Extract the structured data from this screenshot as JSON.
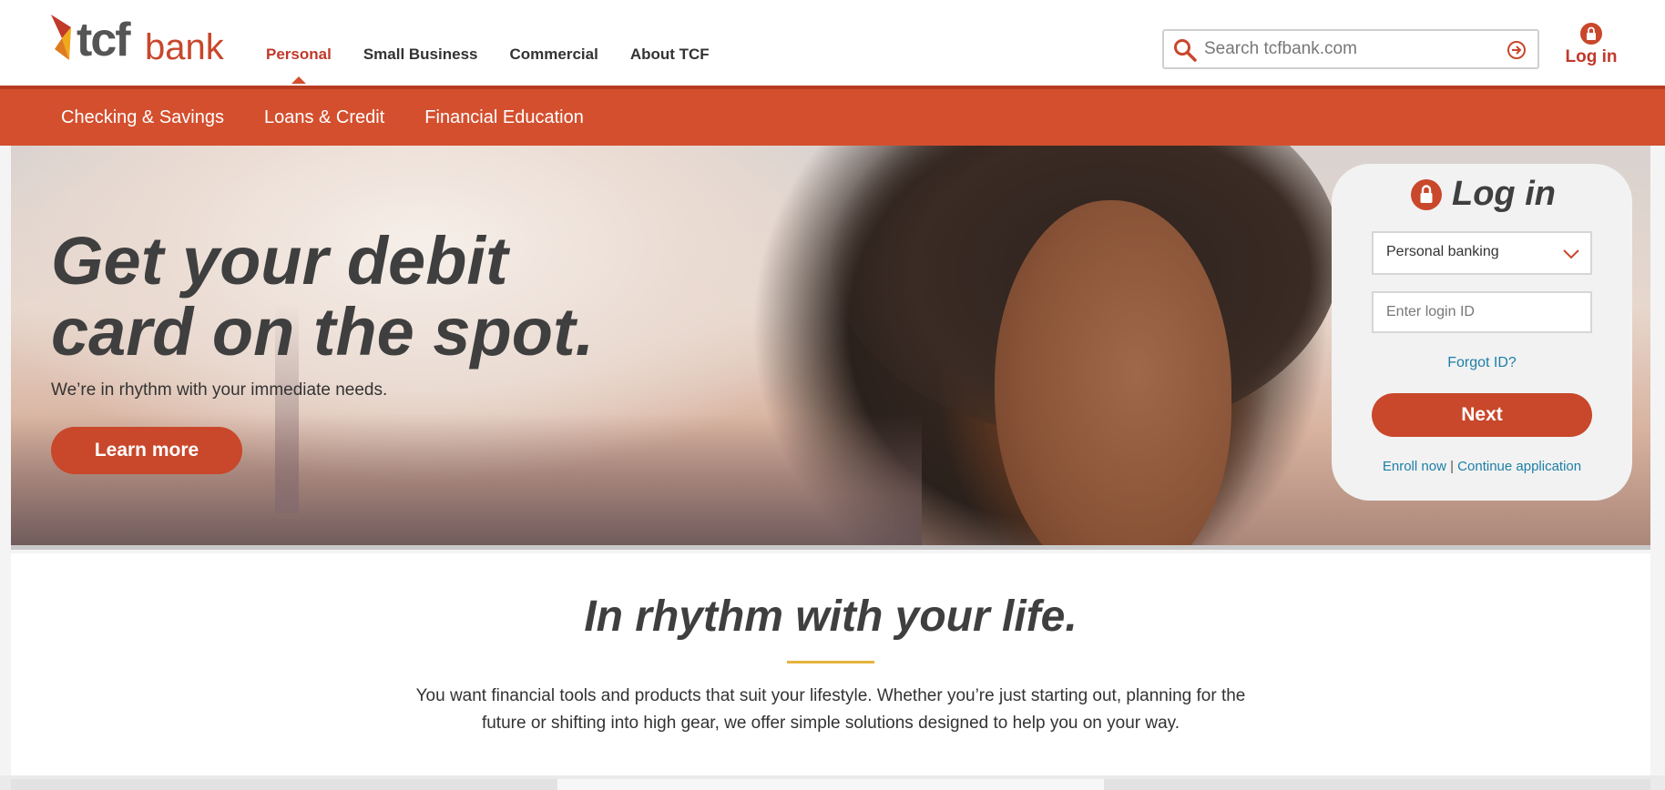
{
  "header": {
    "logo": {
      "wordmark": "tcf",
      "sub": "bank"
    },
    "nav": [
      {
        "label": "Personal",
        "active": true
      },
      {
        "label": "Small Business",
        "active": false
      },
      {
        "label": "Commercial",
        "active": false
      },
      {
        "label": "About TCF",
        "active": false
      }
    ],
    "search": {
      "placeholder": "Search tcfbank.com",
      "value": ""
    },
    "login_label": "Log in"
  },
  "subnav": {
    "items": [
      "Checking & Savings",
      "Loans & Credit",
      "Financial Education"
    ]
  },
  "hero": {
    "title": "Get your debit card on the spot.",
    "subtitle": "We’re in rhythm with your immediate needs.",
    "cta_label": "Learn more"
  },
  "login_card": {
    "title": "Log in",
    "account_type": {
      "selected": "Personal banking"
    },
    "login_id": {
      "placeholder": "Enter login ID",
      "value": ""
    },
    "forgot_label": "Forgot ID?",
    "next_label": "Next",
    "enroll_label": "Enroll now",
    "separator": "|",
    "continue_label": "Continue application"
  },
  "content": {
    "heading": "In rhythm with your life.",
    "paragraph": "You want financial tools and products that suit your lifestyle. Whether you’re just starting out, planning for the future or shifting into high gear, we offer simple solutions designed to help you on your way."
  },
  "colors": {
    "brand_red": "#d44f2e",
    "button_red": "#c9472b",
    "link_blue": "#1c7fa6",
    "accent_gold": "#e6b43c"
  },
  "icons": [
    "tcf-logo-icon",
    "search-icon",
    "search-go-icon",
    "lock-icon",
    "chevron-down-icon"
  ]
}
